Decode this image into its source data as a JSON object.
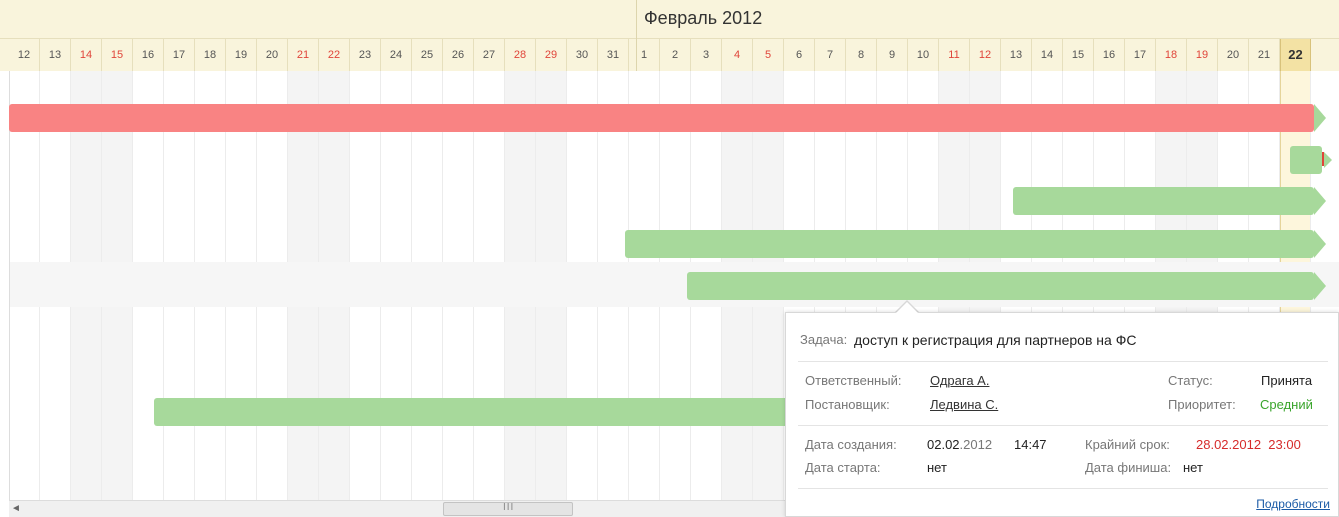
{
  "header": {
    "month_title": "Февраль 2012",
    "days": [
      {
        "label": "12",
        "weekend": false
      },
      {
        "label": "13",
        "weekend": false
      },
      {
        "label": "14",
        "weekend": true
      },
      {
        "label": "15",
        "weekend": true
      },
      {
        "label": "16",
        "weekend": false
      },
      {
        "label": "17",
        "weekend": false
      },
      {
        "label": "18",
        "weekend": false
      },
      {
        "label": "19",
        "weekend": false
      },
      {
        "label": "20",
        "weekend": false
      },
      {
        "label": "21",
        "weekend": true
      },
      {
        "label": "22",
        "weekend": true
      },
      {
        "label": "23",
        "weekend": false
      },
      {
        "label": "24",
        "weekend": false
      },
      {
        "label": "25",
        "weekend": false
      },
      {
        "label": "26",
        "weekend": false
      },
      {
        "label": "27",
        "weekend": false
      },
      {
        "label": "28",
        "weekend": true
      },
      {
        "label": "29",
        "weekend": true
      },
      {
        "label": "30",
        "weekend": false
      },
      {
        "label": "31",
        "weekend": false
      },
      {
        "label": "1",
        "weekend": false
      },
      {
        "label": "2",
        "weekend": false
      },
      {
        "label": "3",
        "weekend": false
      },
      {
        "label": "4",
        "weekend": true
      },
      {
        "label": "5",
        "weekend": true
      },
      {
        "label": "6",
        "weekend": false
      },
      {
        "label": "7",
        "weekend": false
      },
      {
        "label": "8",
        "weekend": false
      },
      {
        "label": "9",
        "weekend": false
      },
      {
        "label": "10",
        "weekend": false
      },
      {
        "label": "11",
        "weekend": true
      },
      {
        "label": "12",
        "weekend": true
      },
      {
        "label": "13",
        "weekend": false
      },
      {
        "label": "14",
        "weekend": false
      },
      {
        "label": "15",
        "weekend": false
      },
      {
        "label": "16",
        "weekend": false
      },
      {
        "label": "17",
        "weekend": false
      },
      {
        "label": "18",
        "weekend": true
      },
      {
        "label": "19",
        "weekend": true
      },
      {
        "label": "20",
        "weekend": false
      },
      {
        "label": "21",
        "weekend": false
      },
      {
        "label": "22",
        "weekend": false,
        "today": true
      }
    ]
  },
  "tooltip": {
    "task_label": "Задача:",
    "task_name": "доступ к регистрация для партнеров на ФС",
    "responsible_label": "Ответственный:",
    "responsible_value": "Одрага А.",
    "creator_label": "Постановщик:",
    "creator_value": "Ледвина С.",
    "status_label": "Статус:",
    "status_value": "Принята",
    "priority_label": "Приоритет:",
    "priority_value": "Средний",
    "created_label": "Дата создания:",
    "created_date_bold": "02.02",
    "created_date_rest": ".2012",
    "created_time": "14:47",
    "deadline_label": "Крайний срок:",
    "deadline_value": "28.02.2012  23:00",
    "start_label": "Дата старта:",
    "start_value": "нет",
    "finish_label": "Дата финиша:",
    "finish_value": "нет",
    "details_link": "Подробности"
  },
  "scrollbar": {
    "grip": "III",
    "left_arrow": "◄"
  },
  "colors": {
    "overdue_bar": "#f98383",
    "task_bar": "#a7d99b",
    "weekend_text": "#e0453a",
    "header_bg": "#f9f4dc"
  }
}
